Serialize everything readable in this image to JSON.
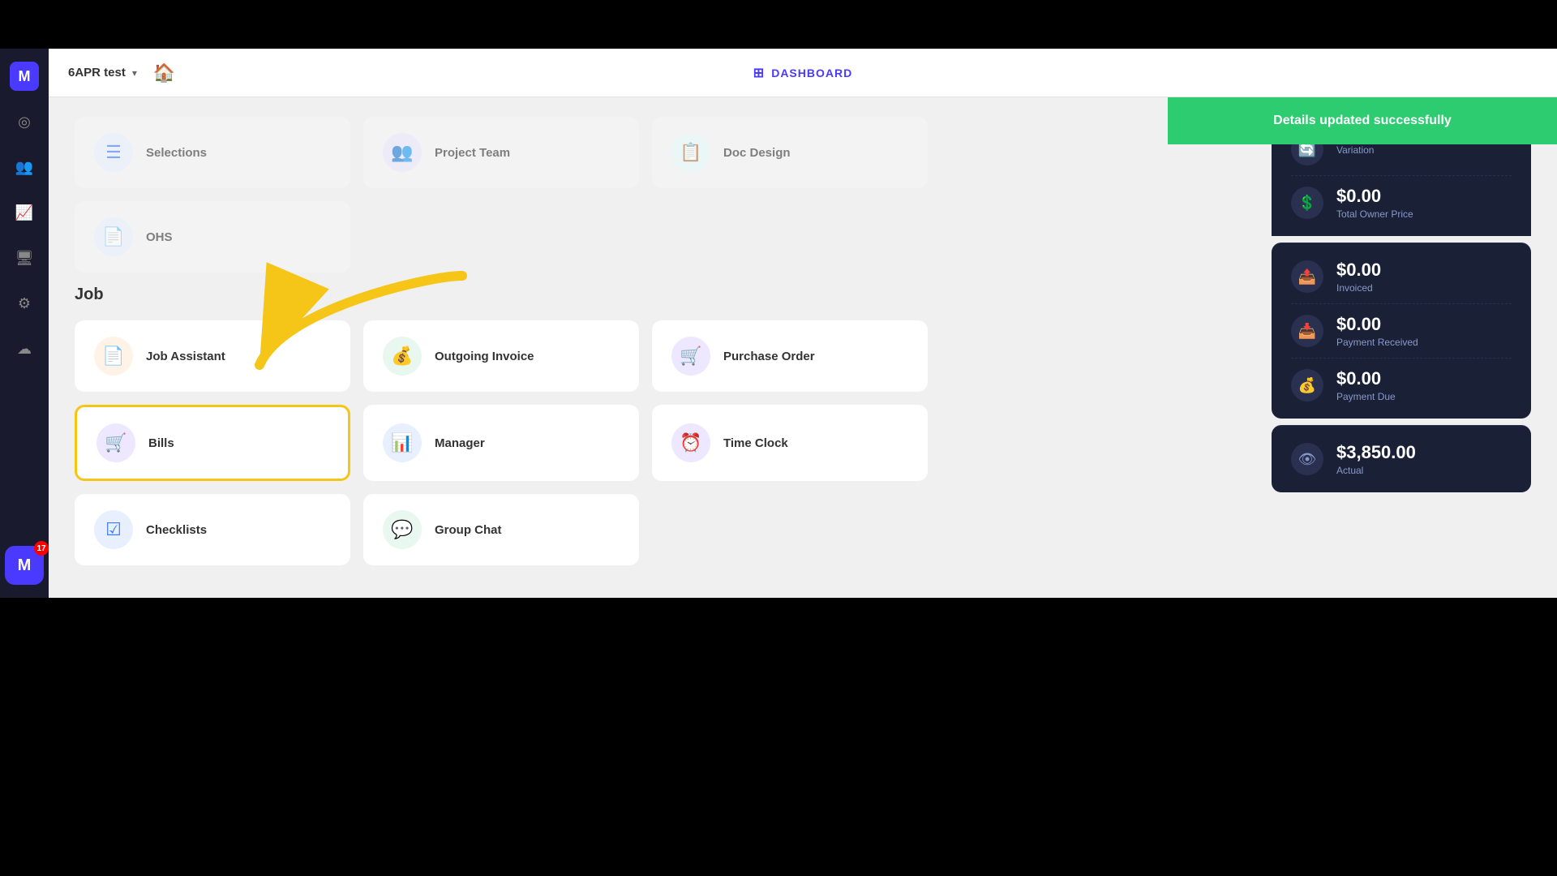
{
  "app": {
    "title": "M",
    "notification_count": "17"
  },
  "header": {
    "project_name": "6APR test",
    "dashboard_label": "DASHBOARD"
  },
  "sidebar_icons": [
    "◎",
    "👥",
    "📈",
    "🖥",
    "⚙",
    "☁"
  ],
  "toast": {
    "message": "Details updated successfully"
  },
  "sections": {
    "top_items": [
      {
        "label": "Selections",
        "icon": "☰",
        "icon_class": "icon-blue"
      },
      {
        "label": "Project Team",
        "icon": "👥",
        "icon_class": "icon-purple"
      },
      {
        "label": "Doc Design",
        "icon": "📋",
        "icon_class": "icon-teal"
      }
    ],
    "ohs_item": {
      "label": "OHS",
      "icon": "📄",
      "icon_class": "icon-blue"
    },
    "job_section": "Job",
    "job_items_row1": [
      {
        "label": "Job Assistant",
        "icon": "📄",
        "icon_class": "icon-orange"
      },
      {
        "label": "Outgoing Invoice",
        "icon": "💰",
        "icon_class": "icon-green"
      },
      {
        "label": "Purchase Order",
        "icon": "🛒",
        "icon_class": "icon-purple"
      }
    ],
    "job_items_row2": [
      {
        "label": "Bills",
        "icon": "🛒",
        "icon_class": "icon-purple",
        "highlighted": true
      },
      {
        "label": "Manager",
        "icon": "📊",
        "icon_class": "icon-blue"
      },
      {
        "label": "Time Clock",
        "icon": "⏰",
        "icon_class": "icon-purple"
      }
    ],
    "job_items_row3": [
      {
        "label": "Checklists",
        "icon": "☑",
        "icon_class": "icon-blue"
      },
      {
        "label": "Group Chat",
        "icon": "💬",
        "icon_class": "icon-green"
      }
    ]
  },
  "right_panel": {
    "cards": [
      {
        "icon": "🔄",
        "amount": "",
        "label": "Variation",
        "has_divider": false
      },
      {
        "icon": "💲",
        "amount": "$0.00",
        "label": "Total Owner Price",
        "has_divider": false
      }
    ],
    "cards2": [
      {
        "icon": "📤",
        "amount": "$0.00",
        "label": "Invoiced"
      },
      {
        "icon": "📥",
        "amount": "$0.00",
        "label": "Payment Received"
      },
      {
        "icon": "💰",
        "amount": "$0.00",
        "label": "Payment Due"
      }
    ],
    "cards3": [
      {
        "icon": "👁",
        "amount": "$3,850.00",
        "label": "Actual"
      }
    ]
  }
}
